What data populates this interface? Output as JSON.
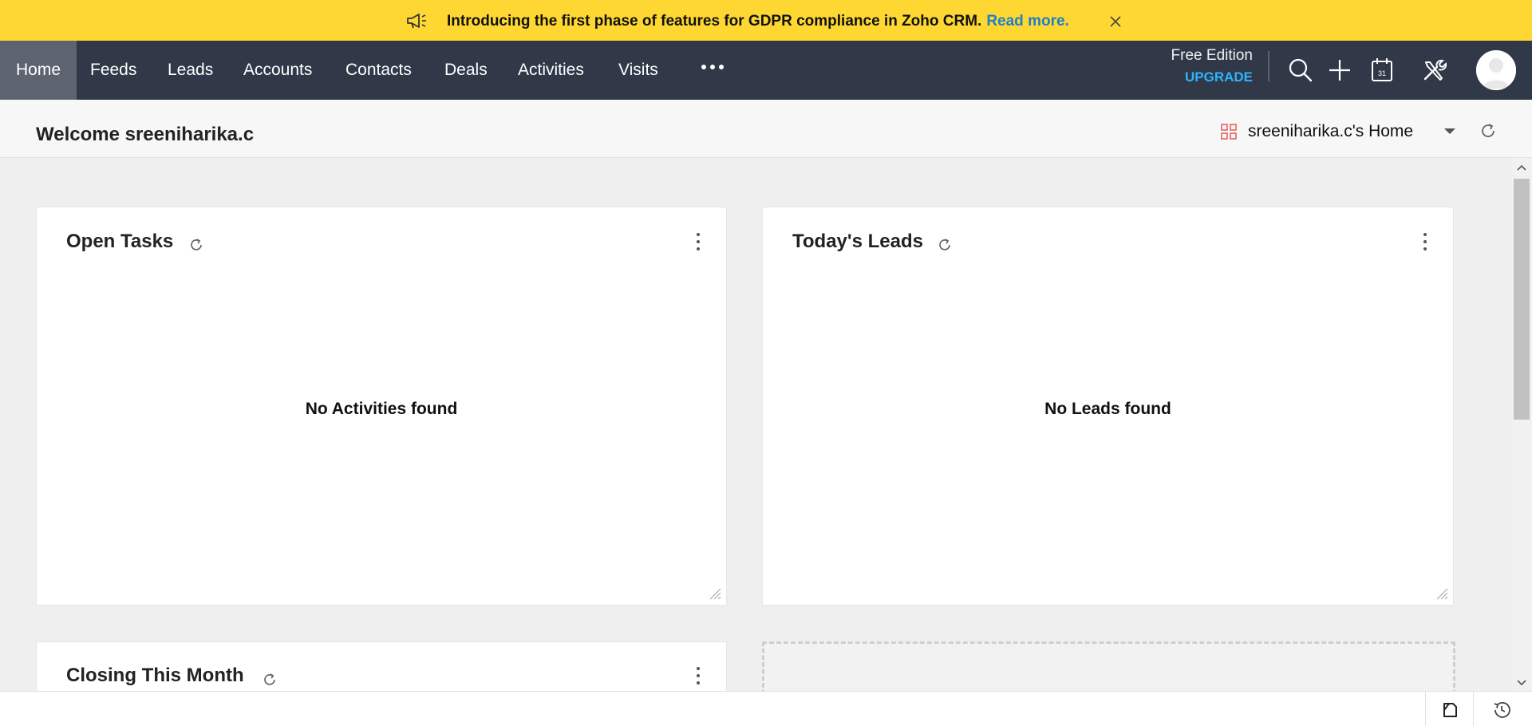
{
  "banner": {
    "message": "Introducing the first phase of features for GDPR compliance in Zoho CRM.",
    "link": "Read more."
  },
  "nav": {
    "items": [
      "Home",
      "Feeds",
      "Leads",
      "Accounts",
      "Contacts",
      "Deals",
      "Activities",
      "Visits"
    ],
    "active": "Home",
    "edition": "Free Edition",
    "upgrade": "UPGRADE",
    "icons": [
      "megaphone-icon",
      "more-icon",
      "search-icon",
      "plus-icon",
      "calendar-icon",
      "setup-tools-icon",
      "avatar"
    ],
    "calendar_day": "31"
  },
  "header": {
    "welcome": "Welcome sreeniharika.c",
    "home_selector": "sreeniharika.c's Home"
  },
  "widgets": {
    "open_tasks": {
      "title": "Open Tasks",
      "empty": "No Activities found"
    },
    "todays_leads": {
      "title": "Today's Leads",
      "empty": "No Leads found"
    },
    "closing_month": {
      "title": "Closing This Month"
    }
  },
  "colors": {
    "banner": "#ffd732",
    "nav_bg": "#313949",
    "nav_active": "#5d6470",
    "link": "#1e7fc7",
    "upgrade": "#2ab5ff",
    "grid_icon": "#e45a5a"
  }
}
